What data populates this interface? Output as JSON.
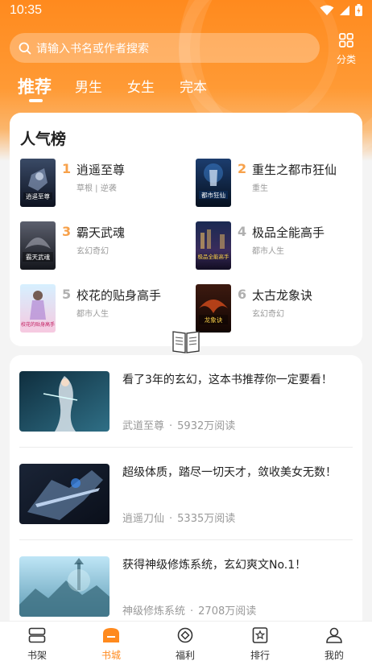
{
  "status_bar": {
    "time": "10:35"
  },
  "search": {
    "placeholder": "请输入书名或作者搜索"
  },
  "category_button": {
    "label": "分类"
  },
  "tabs": [
    {
      "label": "推荐",
      "active": true
    },
    {
      "label": "男生",
      "active": false
    },
    {
      "label": "女生",
      "active": false
    },
    {
      "label": "完本",
      "active": false
    }
  ],
  "popular": {
    "title": "人气榜",
    "items": [
      {
        "rank": "1",
        "title": "逍遥至尊",
        "tags": "草根 | 逆袭",
        "cover_text": "逍遥至尊"
      },
      {
        "rank": "2",
        "title": "重生之都市狂仙",
        "tags": "重生",
        "cover_text": "都市狂仙"
      },
      {
        "rank": "3",
        "title": "霸天武魂",
        "tags": "玄幻奇幻",
        "cover_text": "霸天武魂"
      },
      {
        "rank": "4",
        "title": "极品全能高手",
        "tags": "都市人生",
        "cover_text": "极品全能高手"
      },
      {
        "rank": "5",
        "title": "校花的贴身高手",
        "tags": "都市人生",
        "cover_text": "校花的贴身高手"
      },
      {
        "rank": "6",
        "title": "太古龙象诀",
        "tags": "玄幻奇幻",
        "cover_text": "龙象诀"
      }
    ]
  },
  "feed": [
    {
      "title": "看了3年的玄幻，这本书推荐你一定要看！",
      "book": "武道至尊",
      "reads": "5932万阅读"
    },
    {
      "title": "超级体质，踏尽一切天才，敛收美女无数！",
      "book": "逍遥刀仙",
      "reads": "5335万阅读"
    },
    {
      "title": "获得神级修炼系统，玄幻爽文No.1！",
      "book": "神级修炼系统",
      "reads": "2708万阅读"
    }
  ],
  "meta_separator": "·",
  "bottom_nav": [
    {
      "label": "书架",
      "icon": "bookshelf-icon",
      "active": false
    },
    {
      "label": "书城",
      "icon": "bookstore-icon",
      "active": true
    },
    {
      "label": "福利",
      "icon": "welfare-icon",
      "active": false
    },
    {
      "label": "排行",
      "icon": "ranking-icon",
      "active": false
    },
    {
      "label": "我的",
      "icon": "profile-icon",
      "active": false
    }
  ],
  "colors": {
    "accent": "#ff8a1e",
    "rank_top": "#f7a14a",
    "rank_low": "#b0b0b0"
  }
}
